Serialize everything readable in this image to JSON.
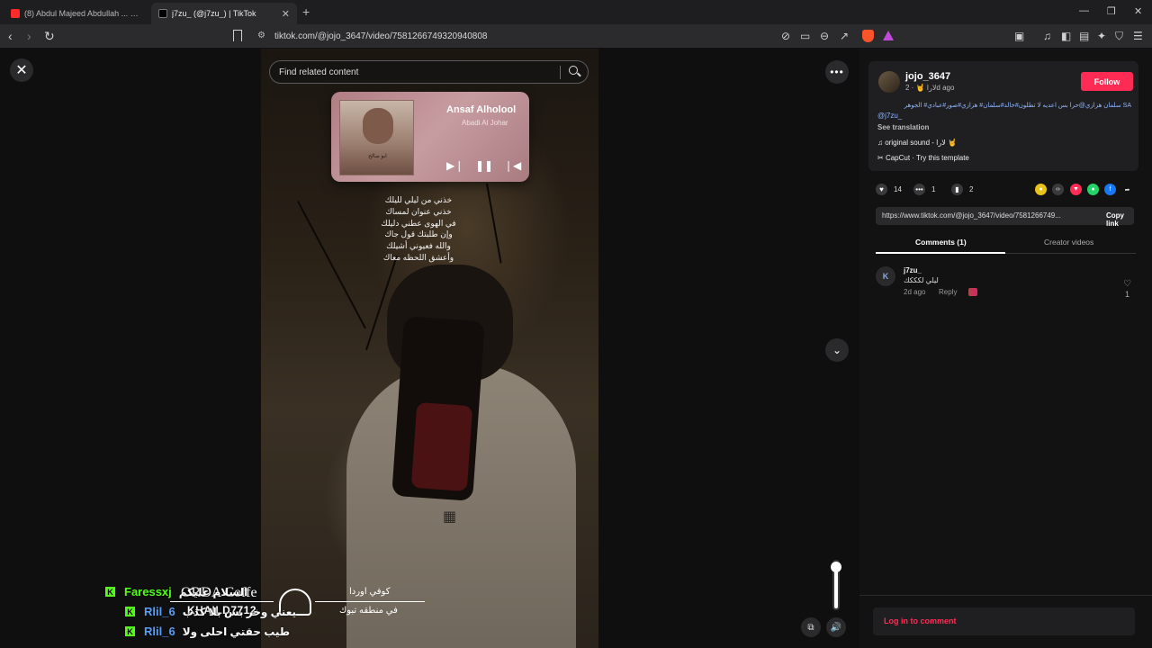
{
  "browser": {
    "tabs": [
      {
        "title": "(8) Abdul Majeed Abdullah ... Fezi La",
        "icon": "youtube-icon"
      },
      {
        "title": "j7zu_ (@j7zu_) | TikTok",
        "icon": "tiktok-icon"
      }
    ],
    "new_tab": "+",
    "url": "tiktok.com/@jojo_3647/video/7581266749320940808"
  },
  "video": {
    "search_placeholder": "Find related content",
    "music_card": {
      "song": "Ansaf Alholool",
      "artist": "Abadi Al Johar",
      "album_caption": "ابو صالح"
    },
    "lyrics": [
      "خذني من ليلي لليلك",
      "خذني عنوان لمساك",
      "في الهوى عطني دليلك",
      "وإن طلبتك قول جاك",
      "والله فعيوني أشيلك",
      "وأعشق اللحظه معاك"
    ],
    "watermark": {
      "brand": "ORDA Coffe",
      "handle": "KHAILD7712",
      "ar_line1": "كوفي اوردا",
      "ar_line2": "في منطقه تبوك"
    }
  },
  "chat": [
    {
      "badge": "K",
      "name": "Faressxj",
      "name_color": "#53fc18",
      "message": "السلام عليكم"
    },
    {
      "badge": "K",
      "name": "Rlil_6",
      "name_color": "#5b9cf5",
      "message": "يعني وخر بس بلا كذب"
    },
    {
      "badge": "K",
      "name": "Rlil_6",
      "name_color": "#5b9cf5",
      "message": "طيب حقتي احلى ولا"
    }
  ],
  "sidebar": {
    "username": "jojo_3647",
    "subline": "لارا 🤘 · 2d ago",
    "follow_label": "Follow",
    "caption_tags": "SA سلمان هزازي@حرا بس اعديه لا تطلون#خالد#سلمان# هزازي#صور#عبادي# الجوهر",
    "mention": "@j7zu_",
    "see_translation": "See translation",
    "sound": "original sound - لارا 🤘",
    "capcut": "CapCut · Try this template",
    "likes": "14",
    "comments_count": "1",
    "saves": "2",
    "share_url": "https://www.tiktok.com/@jojo_3647/video/7581266749...",
    "copy_link": "Copy link",
    "tab_comments": "Comments (1)",
    "tab_creator": "Creator videos",
    "comment": {
      "user": "j7zu_",
      "text": "ليلي لكككك",
      "time": "2d ago",
      "reply": "Reply",
      "likes": "1"
    },
    "login_to_comment": "Log in to comment"
  },
  "colors": {
    "accent": "#fe2c55",
    "kick": "#53fc18"
  }
}
